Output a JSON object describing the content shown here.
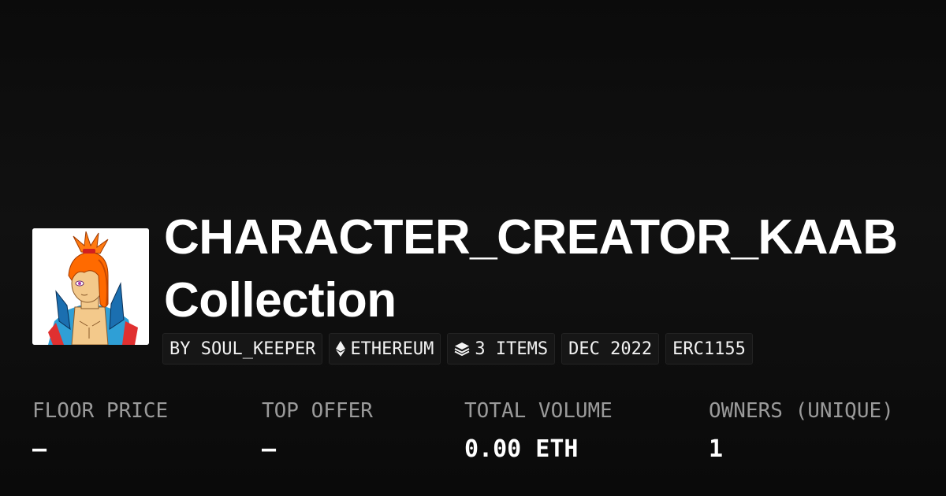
{
  "collection": {
    "title_line1": "CHARACTER_CREATOR_KAAB",
    "title_line2": "Collection",
    "avatar_alt": "collection-avatar"
  },
  "tags": {
    "creator": "BY SOUL_KEEPER",
    "chain": "ETHEREUM",
    "items": "3 ITEMS",
    "date": "DEC 2022",
    "standard": "ERC1155"
  },
  "stats": {
    "floor_price": {
      "label": "FLOOR PRICE",
      "value": "—"
    },
    "top_offer": {
      "label": "TOP OFFER",
      "value": "—"
    },
    "total_volume": {
      "label": "TOTAL VOLUME",
      "value": "0.00 ETH"
    },
    "owners": {
      "label": "OWNERS (UNIQUE)",
      "value": "1"
    }
  },
  "colors": {
    "background": "#0b0b0b",
    "tag_background": "#161616",
    "label_gray": "#9a9a9a",
    "text_white": "#ffffff"
  }
}
